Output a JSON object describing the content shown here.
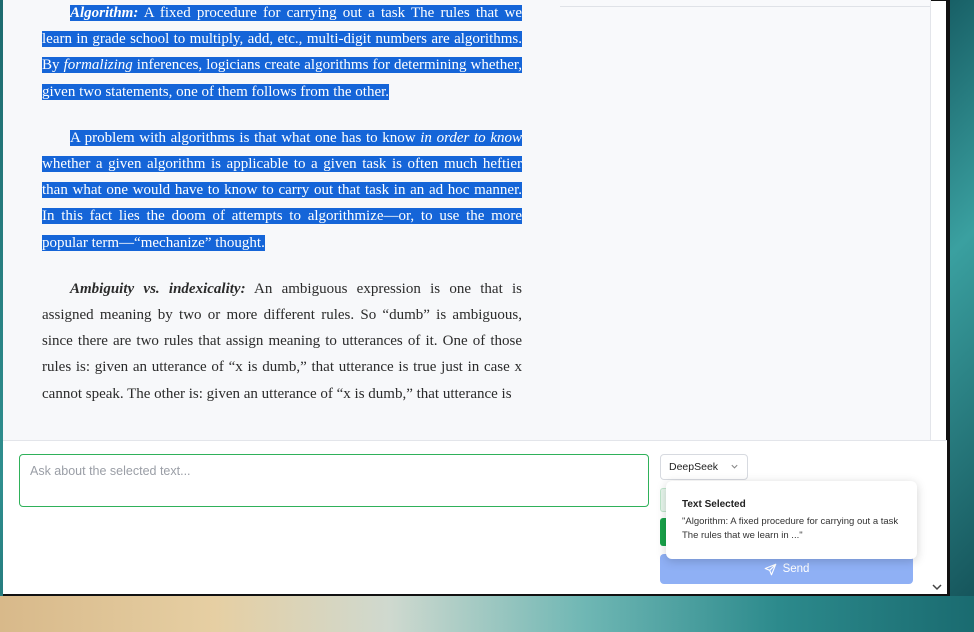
{
  "reader": {
    "p1": {
      "term": "Algorithm:",
      "t1": " A fixed procedure for carrying out a task The rules that we learn in grade school to multiply, add, etc., multi-digit numbers are algorithms. By ",
      "em1": "formalizing",
      "t2": " inferences, logicians create algorithms for determining whether, given two statements, one of them follows from the other."
    },
    "p2": {
      "t1": "A problem with algorithms is that what one has to know ",
      "em1": "in order to know",
      "t2": " whether a given algorithm is applicable to a given task is often much heftier than what one would have to know to carry out that task in an ad hoc manner. In this fact lies the doom of attempts to algorithmize—or, to use the more popular term—“mechanize” thought."
    },
    "p3": {
      "term": "Ambiguity vs. indexicality:",
      "t1": " An ambiguous expression is one that is assigned meaning by two or more different rules. So “dumb” is ambiguous, since there are two rules that assign meaning to utterances of it. One of those rules is: given an utterance of “x is dumb,” that utterance is true just in case x cannot speak. The other is: given an utterance of “x is dumb,” that utterance is"
    }
  },
  "chat": {
    "placeholder": "Ask about the selected text...",
    "value": "",
    "model": "DeepSeek",
    "send_label": "Send"
  },
  "tooltip": {
    "title": "Text Selected",
    "body": "\"Algorithm: A fixed procedure for carrying out a task The rules that we learn in ...\""
  },
  "icons": {
    "model_chevron": "chevron-down-icon",
    "send": "send-icon",
    "scroll": "chevron-down-icon"
  },
  "colors": {
    "selection": "#1565d8",
    "input_border": "#2fb15a",
    "send_button": "#8fb0f5",
    "accent_green": "#19a34a"
  }
}
